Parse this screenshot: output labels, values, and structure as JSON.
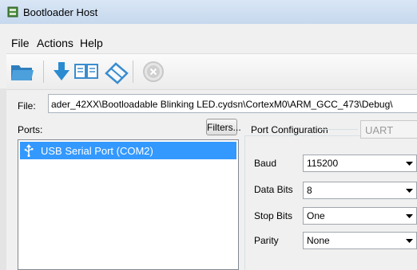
{
  "window": {
    "title": "Bootloader Host"
  },
  "menu": {
    "file": "File",
    "actions": "Actions",
    "help": "Help"
  },
  "toolbar": {
    "icons": [
      "open-folder-icon",
      "program-icon",
      "verify-icon",
      "erase-icon",
      "abort-icon"
    ]
  },
  "file": {
    "label": "File:",
    "path": "ader_42XX\\Bootloadable Blinking LED.cydsn\\CortexM0\\ARM_GCC_473\\Debug\\"
  },
  "ports": {
    "label": "Ports:",
    "filters_label": "Filters...",
    "items": [
      {
        "label": "USB Serial Port (COM2)",
        "selected": true
      }
    ]
  },
  "port_config": {
    "title": "Port Configuration",
    "type": "UART",
    "fields": [
      {
        "label": "Baud",
        "value": "115200"
      },
      {
        "label": "Data Bits",
        "value": "8"
      },
      {
        "label": "Stop Bits",
        "value": "One"
      },
      {
        "label": "Parity",
        "value": "None"
      }
    ]
  },
  "colors": {
    "selection": "#3399ff",
    "titlebar": "#c6d8ee",
    "abort_disabled": "#c8c8c8"
  }
}
